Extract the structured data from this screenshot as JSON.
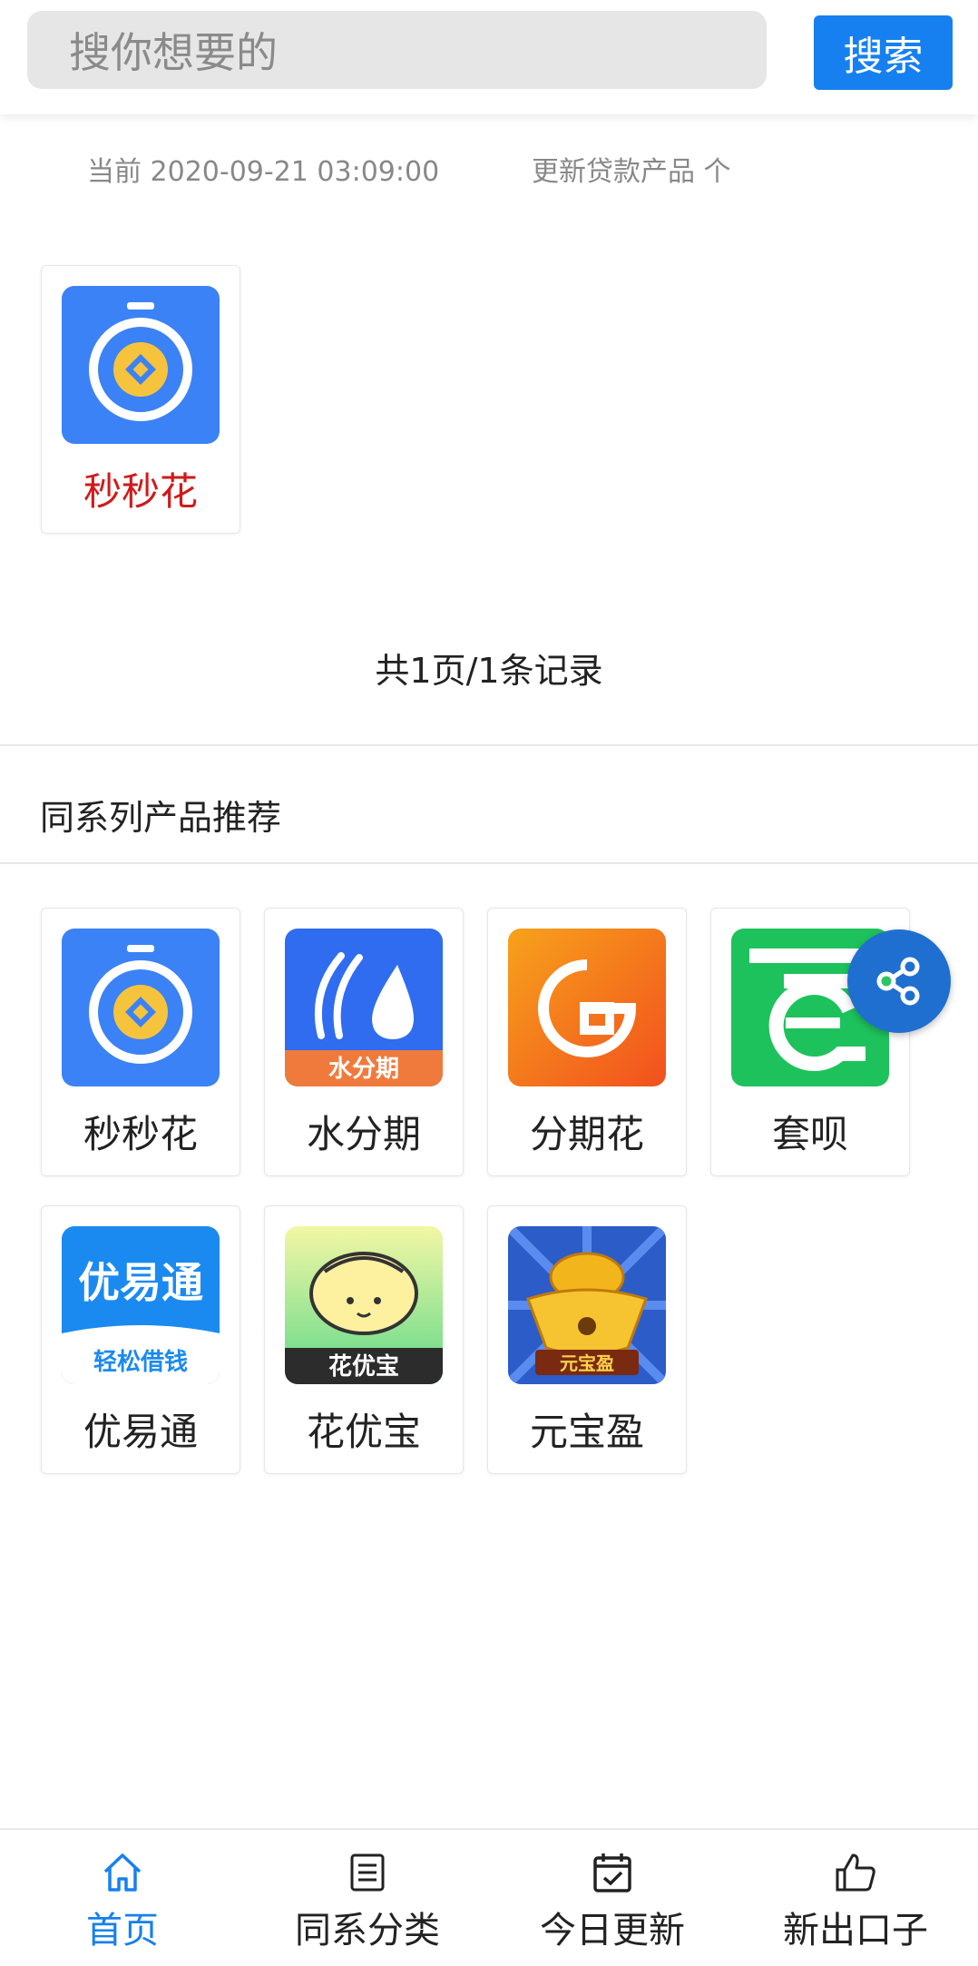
{
  "header": {
    "search_placeholder": "搜你想要的",
    "search_button": "搜索"
  },
  "meta": {
    "current_time": "当前 2020-09-21 03:09:00",
    "update_text": "更新贷款产品 个"
  },
  "results": [
    {
      "label": "秒秒花",
      "icon": "stopwatch-icon"
    }
  ],
  "pager_text": "共1页/1条记录",
  "recommend": {
    "title": "同系列产品推荐",
    "items": [
      {
        "label": "秒秒花",
        "icon": "stopwatch-icon"
      },
      {
        "label": "水分期",
        "icon": "water-drop-icon",
        "icon_text": "水分期"
      },
      {
        "label": "分期花",
        "icon": "g-logo-icon"
      },
      {
        "label": "套呗",
        "icon": "e-logo-icon"
      },
      {
        "label": "优易通",
        "icon": "youyitong-logo-icon",
        "icon_text": "优易通",
        "icon_subtext": "轻松借钱"
      },
      {
        "label": "花优宝",
        "icon": "gold-ingot-face-icon",
        "icon_text": "花优宝"
      },
      {
        "label": "元宝盈",
        "icon": "gold-ingot-icon",
        "icon_text": "元宝盈"
      }
    ]
  },
  "nav": {
    "items": [
      {
        "label": "首页",
        "icon": "home-icon",
        "active": true
      },
      {
        "label": "同系分类",
        "icon": "list-icon",
        "active": false
      },
      {
        "label": "今日更新",
        "icon": "calendar-check-icon",
        "active": false
      },
      {
        "label": "新出口子",
        "icon": "thumbs-up-icon",
        "active": false
      }
    ]
  },
  "colors": {
    "accent": "#1680f0",
    "result_label": "#d01a1a",
    "share_fab": "#1f6fd0"
  }
}
